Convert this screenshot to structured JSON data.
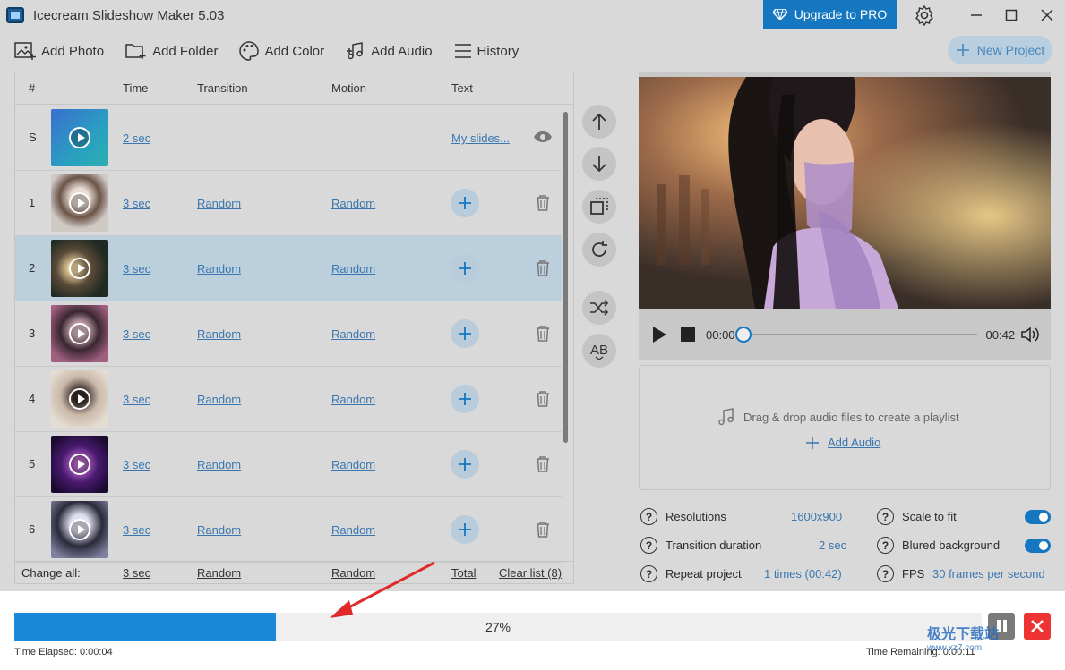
{
  "window": {
    "title": "Icecream Slideshow Maker 5.03",
    "upgrade_label": "Upgrade to PRO"
  },
  "toolbar": {
    "add_photo": "Add Photo",
    "add_folder": "Add Folder",
    "add_color": "Add Color",
    "add_audio": "Add Audio",
    "history": "History",
    "new_project": "New Project"
  },
  "table": {
    "headers": [
      "#",
      "Time",
      "Transition",
      "Motion",
      "Text"
    ],
    "rows": [
      {
        "num": "S",
        "time": "2 sec",
        "transition": "",
        "motion": "",
        "text": "My slides..."
      },
      {
        "num": "1",
        "time": "3 sec",
        "transition": "Random",
        "motion": "Random"
      },
      {
        "num": "2",
        "time": "3 sec",
        "transition": "Random",
        "motion": "Random"
      },
      {
        "num": "3",
        "time": "3 sec",
        "transition": "Random",
        "motion": "Random"
      },
      {
        "num": "4",
        "time": "3 sec",
        "transition": "Random",
        "motion": "Random"
      },
      {
        "num": "5",
        "time": "3 sec",
        "transition": "Random",
        "motion": "Random"
      },
      {
        "num": "6",
        "time": "3 sec",
        "transition": "Random",
        "motion": "Random"
      }
    ],
    "footer": {
      "change_all": "Change all:",
      "time": "3 sec",
      "transition": "Random",
      "motion": "Random",
      "total": "Total",
      "clear": "Clear list (8)"
    }
  },
  "player": {
    "current": "00:00",
    "duration": "00:42",
    "position": 0.0
  },
  "audio": {
    "hint": "Drag & drop audio files to create a playlist",
    "add": "Add Audio"
  },
  "settings": {
    "resolutions_label": "Resolutions",
    "resolutions_value": "1600x900",
    "transition_label": "Transition duration",
    "transition_value": "2 sec",
    "repeat_label": "Repeat project",
    "repeat_value": "1 times (00:42)",
    "scale_label": "Scale to fit",
    "blured_label": "Blured background",
    "fps_label": "FPS",
    "fps_value": "30 frames per second",
    "scale_on": true,
    "blured_on": true
  },
  "progress": {
    "percent": 27,
    "label": "27%",
    "elapsed": "Time Elapsed: 0:00:04",
    "remaining": "Time Remaining: 0:00:11"
  },
  "watermark": {
    "text": "极光下载站",
    "url": "www.xz7.com"
  },
  "colors": {
    "accent": "#1477c0",
    "link": "#3a77b0",
    "progress": "#1a8ad8",
    "stop": "#e33333"
  }
}
